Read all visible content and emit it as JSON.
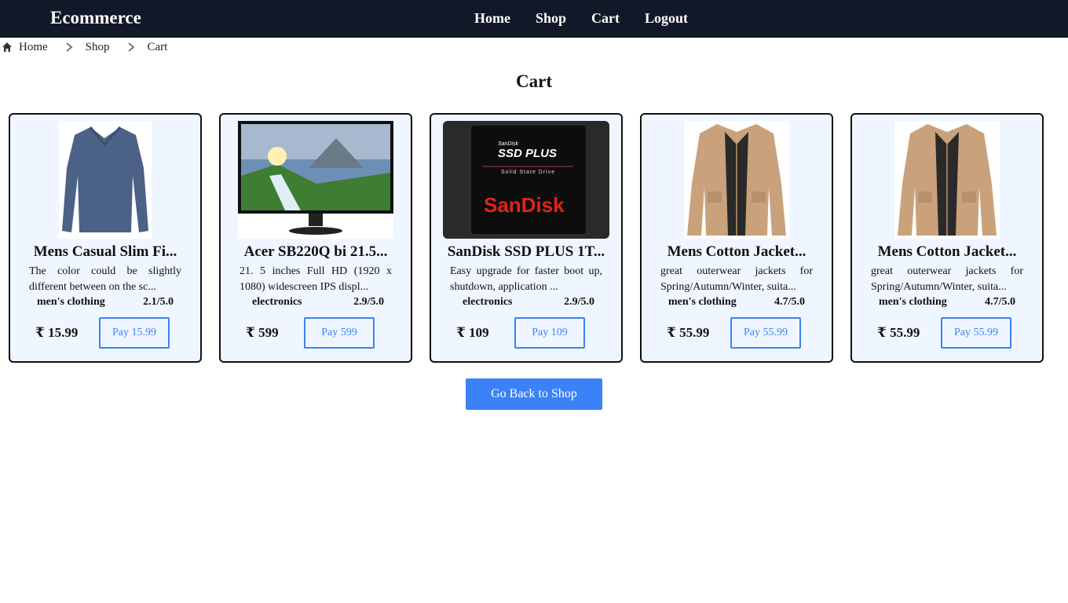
{
  "nav": {
    "brand": "Ecommerce",
    "links": [
      "Home",
      "Shop",
      "Cart",
      "Logout"
    ]
  },
  "breadcrumb": [
    "Home",
    "Shop",
    "Cart"
  ],
  "page_title": "Cart",
  "currency_symbol": "₹",
  "products": [
    {
      "title": "Mens Casual Slim Fi...",
      "description": "The color could be slightly different between on the sc...",
      "category": "men's clothing",
      "rating": "2.1/5.0",
      "price": "₹ 15.99",
      "pay_label": "Pay 15.99",
      "image": "shirt"
    },
    {
      "title": "Acer SB220Q bi 21.5...",
      "description": "21. 5 inches Full HD (1920 x 1080) widescreen IPS displ...",
      "category": "electronics",
      "rating": "2.9/5.0",
      "price": "₹ 599",
      "pay_label": "Pay 599",
      "image": "monitor"
    },
    {
      "title": "SanDisk SSD PLUS 1T...",
      "description": "Easy upgrade for faster boot up, shutdown, application ...",
      "category": "electronics",
      "rating": "2.9/5.0",
      "price": "₹ 109",
      "pay_label": "Pay 109",
      "image": "ssd"
    },
    {
      "title": "Mens Cotton Jacket...",
      "description": "great outerwear jackets for Spring/Autumn/Winter, suita...",
      "category": "men's clothing",
      "rating": "4.7/5.0",
      "price": "₹ 55.99",
      "pay_label": "Pay 55.99",
      "image": "jacket"
    },
    {
      "title": "Mens Cotton Jacket...",
      "description": "great outerwear jackets for Spring/Autumn/Winter, suita...",
      "category": "men's clothing",
      "rating": "4.7/5.0",
      "price": "₹ 55.99",
      "pay_label": "Pay 55.99",
      "image": "jacket"
    }
  ],
  "ssd_image_text": {
    "brand_small": "SanDisk",
    "model": "SSD PLUS",
    "subtitle": "Solid State Drive",
    "logo": "SanDisk"
  },
  "back_button": "Go Back to Shop",
  "colors": {
    "navbar": "#111827",
    "accent": "#3b82f6",
    "card_bg": "#eff6ff"
  }
}
